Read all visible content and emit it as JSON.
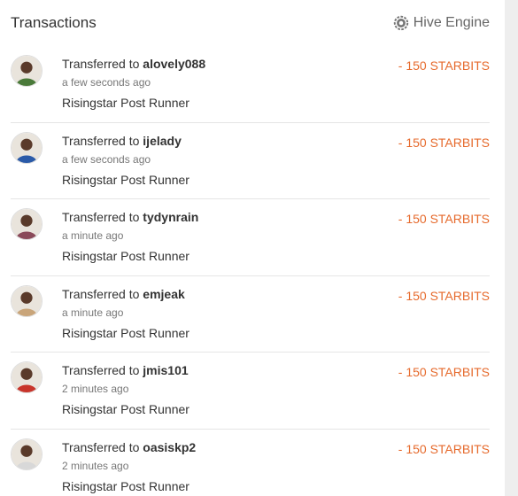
{
  "header": {
    "title": "Transactions",
    "engine_label": "Hive Engine",
    "engine_icon": "gear-icon"
  },
  "colors": {
    "amount": "#e66a2c",
    "divider": "#e5e5e5"
  },
  "transactions": [
    {
      "prefix": "Transferred to",
      "user": "alovely088",
      "time": "a few seconds ago",
      "memo": "Risingstar Post Runner",
      "amount": "- 150 STARBITS",
      "avatar_color": "#4a7a3a"
    },
    {
      "prefix": "Transferred to",
      "user": "ijelady",
      "time": "a few seconds ago",
      "memo": "Risingstar Post Runner",
      "amount": "- 150 STARBITS",
      "avatar_color": "#2a5aa8"
    },
    {
      "prefix": "Transferred to",
      "user": "tydynrain",
      "time": "a minute ago",
      "memo": "Risingstar Post Runner",
      "amount": "- 150 STARBITS",
      "avatar_color": "#8a4a5a"
    },
    {
      "prefix": "Transferred to",
      "user": "emjeak",
      "time": "a minute ago",
      "memo": "Risingstar Post Runner",
      "amount": "- 150 STARBITS",
      "avatar_color": "#c9a57a"
    },
    {
      "prefix": "Transferred to",
      "user": "jmis101",
      "time": "2 minutes ago",
      "memo": "Risingstar Post Runner",
      "amount": "- 150 STARBITS",
      "avatar_color": "#c8342a"
    },
    {
      "prefix": "Transferred to",
      "user": "oasiskp2",
      "time": "2 minutes ago",
      "memo": "Risingstar Post Runner",
      "amount": "- 150 STARBITS",
      "avatar_color": "#d8d8d8"
    }
  ]
}
